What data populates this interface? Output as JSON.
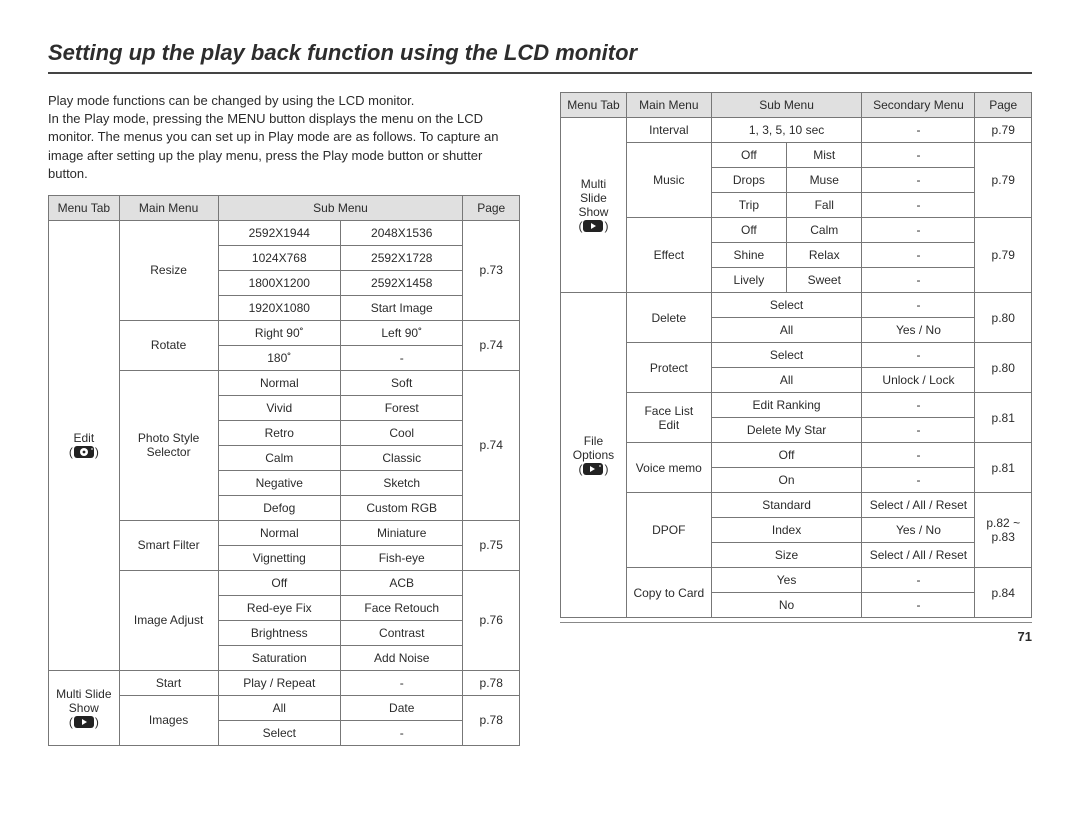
{
  "title": "Setting up the play back function using the LCD monitor",
  "page_number": "71",
  "intro": [
    "Play mode functions can be changed by using the LCD monitor.",
    "In the Play mode, pressing the MENU button displays the menu on the LCD monitor. The menus you can set up in Play mode are as follows. To capture an image after setting up the play menu, press the Play mode button or shutter button."
  ],
  "table1": {
    "headers": [
      "Menu Tab",
      "Main Menu",
      "Sub Menu",
      "Page"
    ],
    "rows": [
      {
        "tab": "Edit",
        "tab_icon": "edit-gear",
        "main": "Resize",
        "subs": [
          [
            "2592X1944",
            "2048X1536"
          ],
          [
            "1024X768",
            "2592X1728"
          ],
          [
            "1800X1200",
            "2592X1458"
          ],
          [
            "1920X1080",
            "Start Image"
          ]
        ],
        "page": "p.73"
      },
      {
        "main": "Rotate",
        "subs": [
          [
            "Right 90˚",
            "Left 90˚"
          ],
          [
            "180˚",
            "-"
          ]
        ],
        "page": "p.74"
      },
      {
        "main": "Photo Style Selector",
        "subs": [
          [
            "Normal",
            "Soft"
          ],
          [
            "Vivid",
            "Forest"
          ],
          [
            "Retro",
            "Cool"
          ],
          [
            "Calm",
            "Classic"
          ],
          [
            "Negative",
            "Sketch"
          ],
          [
            "Defog",
            "Custom RGB"
          ]
        ],
        "page": "p.74"
      },
      {
        "main": "Smart Filter",
        "subs": [
          [
            "Normal",
            "Miniature"
          ],
          [
            "Vignetting",
            "Fish-eye"
          ]
        ],
        "page": "p.75"
      },
      {
        "main": "Image Adjust",
        "subs": [
          [
            "Off",
            "ACB"
          ],
          [
            "Red-eye Fix",
            "Face Retouch"
          ],
          [
            "Brightness",
            "Contrast"
          ],
          [
            "Saturation",
            "Add Noise"
          ]
        ],
        "page": "p.76"
      },
      {
        "tab": "Multi Slide Show",
        "tab_icon": "slide",
        "main": "Start",
        "subs": [
          [
            "Play / Repeat",
            "-"
          ]
        ],
        "page": "p.78"
      },
      {
        "main": "Images",
        "subs": [
          [
            "All",
            "Date"
          ],
          [
            "Select",
            "-"
          ]
        ],
        "page": "p.78"
      }
    ]
  },
  "table2": {
    "headers": [
      "Menu Tab",
      "Main Menu",
      "Sub Menu",
      "Secondary Menu",
      "Page"
    ],
    "slide_tab": "Multi Slide Show",
    "slide_rows": [
      {
        "main": "Interval",
        "subs": [
          [
            "1, 3, 5, 10 sec",
            "",
            "-"
          ]
        ],
        "page": "p.79"
      },
      {
        "main": "Music",
        "subs": [
          [
            "Off",
            "Mist",
            "-"
          ],
          [
            "Drops",
            "Muse",
            "-"
          ],
          [
            "Trip",
            "Fall",
            "-"
          ]
        ],
        "page": "p.79"
      },
      {
        "main": "Effect",
        "subs": [
          [
            "Off",
            "Calm",
            "-"
          ],
          [
            "Shine",
            "Relax",
            "-"
          ],
          [
            "Lively",
            "Sweet",
            "-"
          ]
        ],
        "page": "p.79"
      }
    ],
    "file_tab": "File Options",
    "file_rows": [
      {
        "main": "Delete",
        "subs": [
          [
            "Select",
            "-"
          ],
          [
            "All",
            "Yes / No"
          ]
        ],
        "page": "p.80"
      },
      {
        "main": "Protect",
        "subs": [
          [
            "Select",
            "-"
          ],
          [
            "All",
            "Unlock / Lock"
          ]
        ],
        "page": "p.80"
      },
      {
        "main": "Face List Edit",
        "subs": [
          [
            "Edit Ranking",
            "-"
          ],
          [
            "Delete My Star",
            "-"
          ]
        ],
        "page": "p.81"
      },
      {
        "main": "Voice memo",
        "subs": [
          [
            "Off",
            "-"
          ],
          [
            "On",
            "-"
          ]
        ],
        "page": "p.81"
      },
      {
        "main": "DPOF",
        "subs": [
          [
            "Standard",
            "Select / All / Reset"
          ],
          [
            "Index",
            "Yes / No"
          ],
          [
            "Size",
            "Select / All / Reset"
          ]
        ],
        "page": "p.82 ~ p.83"
      },
      {
        "main": "Copy to Card",
        "subs": [
          [
            "Yes",
            "-"
          ],
          [
            "No",
            "-"
          ]
        ],
        "page": "p.84"
      }
    ]
  }
}
